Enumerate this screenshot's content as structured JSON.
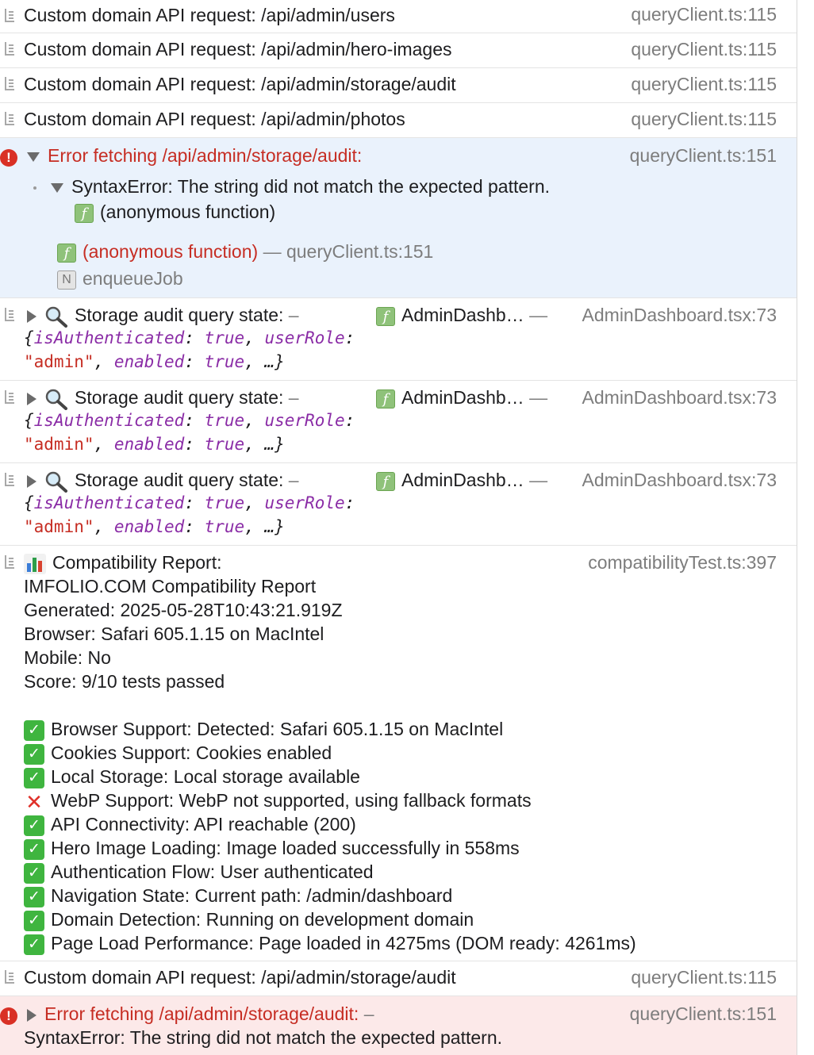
{
  "rows": [
    {
      "message": "Custom domain API request: /api/admin/users",
      "source": "queryClient.ts:115"
    },
    {
      "message": "Custom domain API request: /api/admin/hero-images",
      "source": "queryClient.ts:115"
    },
    {
      "message": "Custom domain API request: /api/admin/storage/audit",
      "source": "queryClient.ts:115"
    },
    {
      "message": "Custom domain API request: /api/admin/photos",
      "source": "queryClient.ts:115"
    }
  ],
  "error1": {
    "message": "Error fetching /api/admin/storage/audit:",
    "source": "queryClient.ts:151",
    "detail": "SyntaxError: The string did not match the expected pattern.",
    "inner_frame": "(anonymous function)",
    "frame1_name": "(anonymous function)",
    "frame1_sep": "—",
    "frame1_source": "queryClient.ts:151",
    "frame2_name": "enqueueJob"
  },
  "audit_rows": [
    {
      "label": "Storage audit query state:",
      "dash": "–",
      "component": "AdminDashb…",
      "sep": "—",
      "source": "AdminDashboard.tsx:73"
    },
    {
      "label": "Storage audit query state:",
      "dash": "–",
      "component": "AdminDashb…",
      "sep": "—",
      "source": "AdminDashboard.tsx:73"
    },
    {
      "label": "Storage audit query state:",
      "dash": "–",
      "component": "AdminDashb…",
      "sep": "—",
      "source": "AdminDashboard.tsx:73"
    }
  ],
  "audit_object": {
    "open": "{",
    "k1": "isAuthenticated",
    "v1": "true",
    "k2": "userRole",
    "v2": "\"admin\"",
    "k3": "enabled",
    "v3": "true",
    "rest": "…}"
  },
  "report": {
    "title": "Compatibility Report:",
    "source": "compatibilityTest.ts:397",
    "lines": [
      "IMFOLIO.COM Compatibility Report",
      "Generated: 2025-05-28T10:43:21.919Z",
      "Browser: Safari 605.1.15 on MacIntel",
      "Mobile: No",
      "Score: 9/10 tests passed"
    ],
    "tests": [
      {
        "pass": true,
        "text": "Browser Support: Detected: Safari 605.1.15 on MacIntel"
      },
      {
        "pass": true,
        "text": "Cookies Support: Cookies enabled"
      },
      {
        "pass": true,
        "text": "Local Storage: Local storage available"
      },
      {
        "pass": false,
        "text": "WebP Support: WebP not supported, using fallback formats"
      },
      {
        "pass": true,
        "text": "API Connectivity: API reachable (200)"
      },
      {
        "pass": true,
        "text": "Hero Image Loading: Image loaded successfully in 558ms"
      },
      {
        "pass": true,
        "text": "Authentication Flow: User authenticated"
      },
      {
        "pass": true,
        "text": "Navigation State: Current path: /admin/dashboard"
      },
      {
        "pass": true,
        "text": "Domain Detection: Running on development domain"
      },
      {
        "pass": true,
        "text": "Page Load Performance: Page loaded in 4275ms (DOM ready: 4261ms)"
      }
    ]
  },
  "last_request": {
    "message": "Custom domain API request: /api/admin/storage/audit",
    "source": "queryClient.ts:115"
  },
  "error2": {
    "message": "Error fetching /api/admin/storage/audit:",
    "dash": "–",
    "source": "queryClient.ts:151",
    "detail": "SyntaxError: The string did not match the expected pattern."
  },
  "icons": {
    "log_gutter": "log-entry-icon",
    "error": "error-icon",
    "function": "function-icon",
    "native": "native-code-icon",
    "magnifier": "magnifying-glass-icon",
    "chart": "bar-chart-icon",
    "pass": "check-mark-icon",
    "fail": "cross-mark-icon"
  },
  "colors": {
    "error_text": "#c62d23",
    "error_bg": "#eaf2fc",
    "error2_bg": "#fce9e9",
    "keyword": "#8a2ca6",
    "source": "#7d7d7d"
  }
}
